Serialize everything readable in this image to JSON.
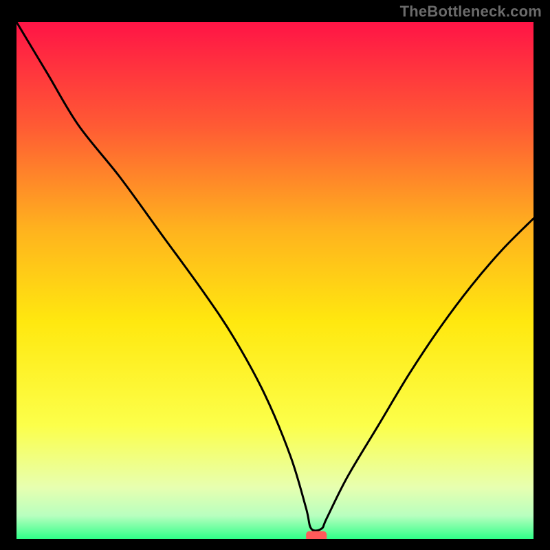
{
  "watermark": "TheBottleneck.com",
  "chart_data": {
    "type": "line",
    "title": "",
    "xlabel": "",
    "ylabel": "",
    "xlim": [
      0,
      100
    ],
    "ylim": [
      0,
      100
    ],
    "grid": false,
    "legend": false,
    "background_gradient_stops": [
      {
        "offset": 0.0,
        "color": "#ff1446"
      },
      {
        "offset": 0.2,
        "color": "#ff5a34"
      },
      {
        "offset": 0.4,
        "color": "#ffb21e"
      },
      {
        "offset": 0.58,
        "color": "#ffe80f"
      },
      {
        "offset": 0.78,
        "color": "#fcff4a"
      },
      {
        "offset": 0.9,
        "color": "#e7ffb0"
      },
      {
        "offset": 0.955,
        "color": "#b8ffbf"
      },
      {
        "offset": 1.0,
        "color": "#2fff88"
      }
    ],
    "series": [
      {
        "name": "bottleneck-curve",
        "stroke": "#000000",
        "x": [
          0,
          6,
          12,
          20,
          28,
          36,
          42,
          48,
          53,
          56,
          57,
          59,
          60,
          64,
          70,
          76,
          82,
          88,
          94,
          100
        ],
        "values": [
          100,
          90,
          80,
          70,
          59,
          48,
          39,
          28,
          16,
          6,
          2,
          2,
          4,
          12,
          22,
          32,
          41,
          49,
          56,
          62
        ]
      }
    ],
    "marker": {
      "name": "minimum-marker",
      "shape": "rounded-rect",
      "fill": "#ff5a5a",
      "x": 58,
      "y": 0,
      "width": 4,
      "height": 2
    }
  }
}
